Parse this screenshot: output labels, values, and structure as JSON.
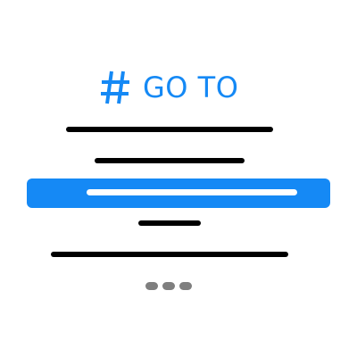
{
  "colors": {
    "accent": "#1589f5",
    "text_line": "#000000",
    "dots": "#7f7f7f",
    "selected_line": "#ffffff",
    "background": "#ffffff"
  },
  "header": {
    "icon": "hash-icon",
    "label": "GO TO"
  },
  "list": {
    "items": [
      {
        "state": "normal"
      },
      {
        "state": "normal"
      },
      {
        "state": "selected"
      },
      {
        "state": "normal"
      },
      {
        "state": "normal"
      }
    ],
    "more_indicator": "ellipsis-icon"
  }
}
